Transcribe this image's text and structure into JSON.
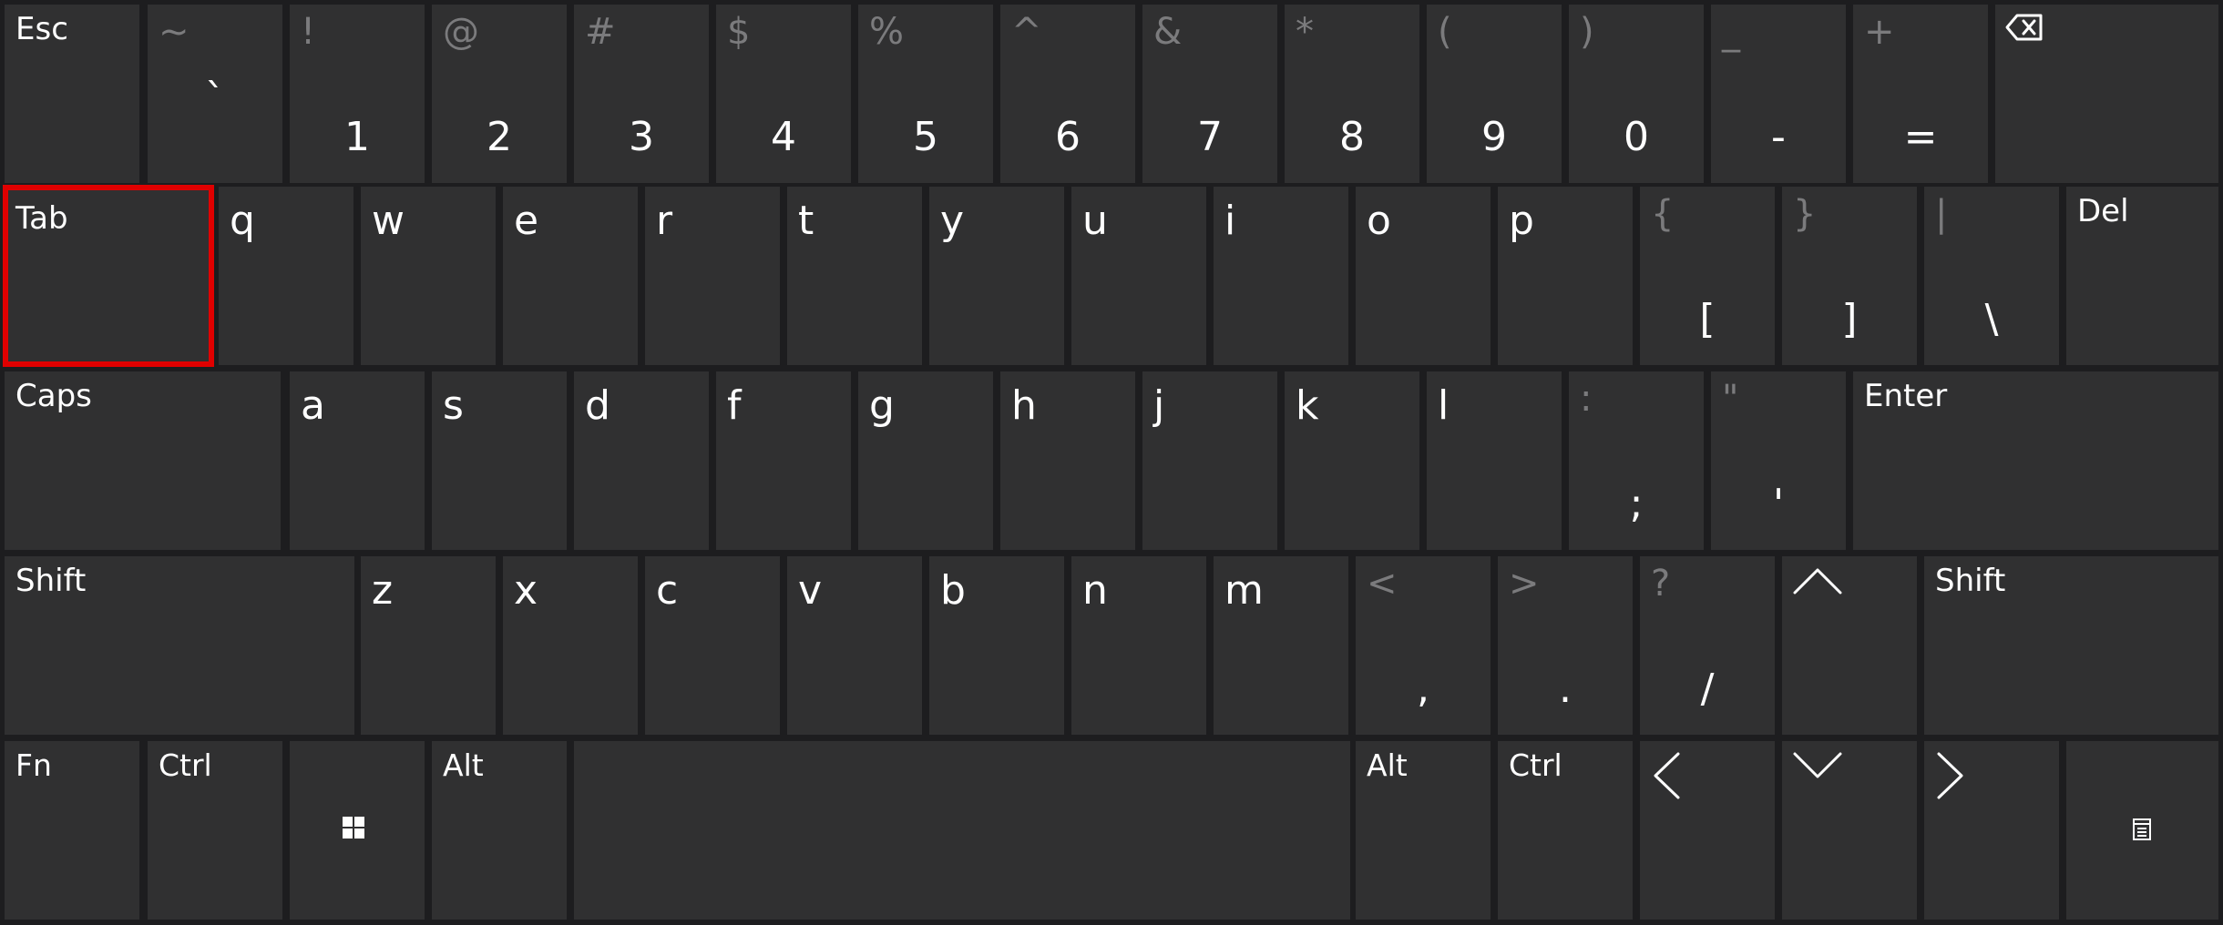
{
  "colors": {
    "background": "#1d1d1f",
    "key": "#303031",
    "text": "#ffffff",
    "secondary_text": "#7b7b7d",
    "highlight": "#e00000"
  },
  "row1": {
    "esc": "Esc",
    "symbols": [
      {
        "shift": "~",
        "base": "`"
      },
      {
        "shift": "!",
        "base": "1"
      },
      {
        "shift": "@",
        "base": "2"
      },
      {
        "shift": "#",
        "base": "3"
      },
      {
        "shift": "$",
        "base": "4"
      },
      {
        "shift": "%",
        "base": "5"
      },
      {
        "shift": "^",
        "base": "6"
      },
      {
        "shift": "&",
        "base": "7"
      },
      {
        "shift": "*",
        "base": "8"
      },
      {
        "shift": "(",
        "base": "9"
      },
      {
        "shift": ")",
        "base": "0"
      },
      {
        "shift": "_",
        "base": "-"
      },
      {
        "shift": "+",
        "base": "="
      }
    ],
    "backspace_icon": "backspace-icon"
  },
  "row2": {
    "tab": "Tab",
    "letters": [
      "q",
      "w",
      "e",
      "r",
      "t",
      "y",
      "u",
      "i",
      "o",
      "p"
    ],
    "symbols": [
      {
        "shift": "{",
        "base": "["
      },
      {
        "shift": "}",
        "base": "]"
      },
      {
        "shift": "|",
        "base": "\\"
      }
    ],
    "del": "Del"
  },
  "row3": {
    "caps": "Caps",
    "letters": [
      "a",
      "s",
      "d",
      "f",
      "g",
      "h",
      "j",
      "k",
      "l"
    ],
    "symbols": [
      {
        "shift": ":",
        "base": ";"
      },
      {
        "shift": "\"",
        "base": "'"
      }
    ],
    "enter": "Enter"
  },
  "row4": {
    "shift_left": "Shift",
    "letters": [
      "z",
      "x",
      "c",
      "v",
      "b",
      "n",
      "m"
    ],
    "symbols": [
      {
        "shift": "<",
        "base": ","
      },
      {
        "shift": ">",
        "base": "."
      },
      {
        "shift": "?",
        "base": "/"
      }
    ],
    "up_icon": "arrow-up-icon",
    "shift_right": "Shift"
  },
  "row5": {
    "fn": "Fn",
    "ctrl_left": "Ctrl",
    "win_icon": "windows-logo-icon",
    "alt_left": "Alt",
    "alt_right": "Alt",
    "ctrl_right": "Ctrl",
    "left_icon": "arrow-left-icon",
    "down_icon": "arrow-down-icon",
    "right_icon": "arrow-right-icon",
    "menu_icon": "context-menu-icon"
  }
}
